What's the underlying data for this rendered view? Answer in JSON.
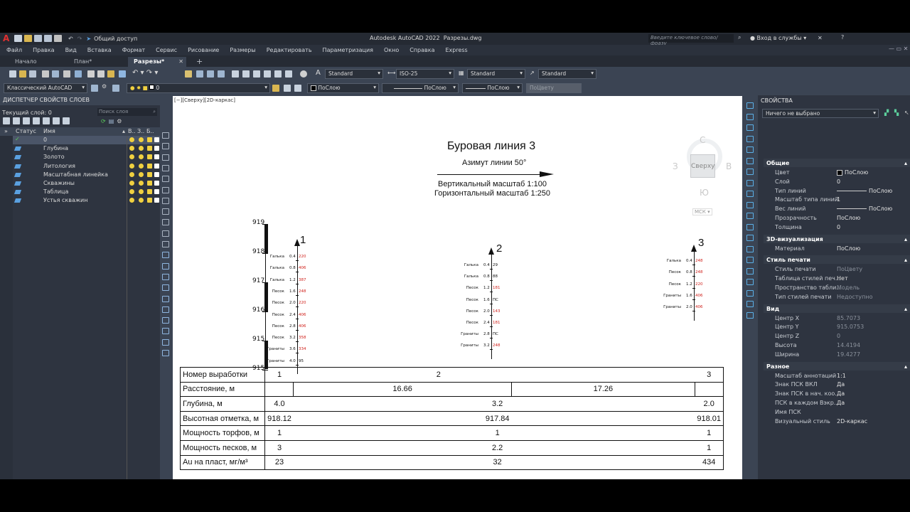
{
  "window": {
    "app_title": "Autodesk AutoCAD 2022",
    "file_name": "Разрезы.dwg",
    "share": "Общий доступ",
    "search_placeholder": "Введите ключевое слово/фразу",
    "sign_in": "Вход в службы"
  },
  "menu": [
    "Файл",
    "Правка",
    "Вид",
    "Вставка",
    "Формат",
    "Сервис",
    "Рисование",
    "Размеры",
    "Редактировать",
    "Параметризация",
    "Окно",
    "Справка",
    "Express"
  ],
  "tabs": [
    {
      "label": "Начало",
      "active": false
    },
    {
      "label": "План*",
      "active": false
    },
    {
      "label": "Разрезы*",
      "active": true
    }
  ],
  "toolbar": {
    "text_style": "Standard",
    "dim_style": "ISO-25",
    "table_style": "Standard",
    "mleader_style": "Standard",
    "workspace": "Классический AutoCAD",
    "layer": "0",
    "color": "ПоСлою",
    "linetype": "ПоСлою",
    "lineweight": "ПоСлою",
    "plotstyle": "ПоЦвету"
  },
  "layer_panel": {
    "title": "ДИСПЕТЧЕР СВОЙСТВ СЛОЕВ",
    "current": "Текущий слой: 0",
    "search_placeholder": "Поиск слоя",
    "col_status": "Статус",
    "col_name": "Имя",
    "col_flags": [
      "В..",
      "З..",
      "Б.."
    ],
    "layers": [
      "0",
      "Глубина",
      "Золото",
      "Литология",
      "Масштабная линейка",
      "Скважины",
      "Таблица",
      "Устья скважин"
    ]
  },
  "viewport_label": "[−][Сверху][2D-каркас]",
  "viewcube": {
    "top": "Сверху",
    "n": "С",
    "s": "Ю",
    "w": "З",
    "e": "В",
    "ucs": "МСК"
  },
  "drawing": {
    "title": "Буровая линия 3",
    "azimuth": "Азимут линии 50°",
    "vscale": "Вертикальный масштаб 1:100",
    "hscale": "Горизонтальный масштаб 1:250",
    "elevations": [
      "919",
      "918",
      "917",
      "916",
      "915",
      "915"
    ],
    "wells": [
      {
        "num": "1",
        "rows": [
          [
            "Галька",
            "0.4",
            "220"
          ],
          [
            "Галька",
            "0.8",
            "406"
          ],
          [
            "Галька",
            "1.2",
            "387"
          ],
          [
            "Песок",
            "1.6",
            "248"
          ],
          [
            "Песок",
            "2.0",
            "220"
          ],
          [
            "Песок",
            "2.4",
            "406"
          ],
          [
            "Песок",
            "2.8",
            "406"
          ],
          [
            "Песок",
            "3.2",
            "358"
          ],
          [
            "Граниты",
            "3.6",
            "334"
          ],
          [
            "Граниты",
            "4.0",
            "95"
          ]
        ]
      },
      {
        "num": "2",
        "rows": [
          [
            "Галька",
            "0.4",
            "29"
          ],
          [
            "Галька",
            "0.8",
            "88"
          ],
          [
            "Песок",
            "1.2",
            "181"
          ],
          [
            "Песок",
            "1.6",
            "ПС"
          ],
          [
            "Песок",
            "2.0",
            "143"
          ],
          [
            "Песок",
            "2.4",
            "181"
          ],
          [
            "Граниты",
            "2.8",
            "ПС"
          ],
          [
            "Граниты",
            "3.2",
            "248"
          ]
        ]
      },
      {
        "num": "3",
        "rows": [
          [
            "Галька",
            "0.4",
            "248"
          ],
          [
            "Песок",
            "0.8",
            "248"
          ],
          [
            "Песок",
            "1.2",
            "220"
          ],
          [
            "Граниты",
            "1.6",
            "406"
          ],
          [
            "Граниты",
            "2.0",
            "406"
          ]
        ]
      }
    ],
    "table": {
      "r1": [
        "Номер выработки",
        "1",
        "2",
        "3"
      ],
      "r2": [
        "Расстояние, м",
        "16.66",
        "17.26"
      ],
      "r3": [
        "Глубина, м",
        "4.0",
        "3.2",
        "2.0"
      ],
      "r4": [
        "Высотная отметка, м",
        "918.12",
        "917.84",
        "918.01"
      ],
      "r5": [
        "Мощность торфов, м",
        "1",
        "1",
        "1"
      ],
      "r6": [
        "Мощность песков, м",
        "3",
        "2.2",
        "1"
      ],
      "r7": [
        "Au на пласт, мг/м³",
        "23",
        "32",
        "434"
      ]
    }
  },
  "properties": {
    "title": "СВОЙСТВА",
    "selection": "Ничего не выбрано",
    "sections": [
      {
        "name": "Общие",
        "rows": [
          [
            "Цвет",
            "ПоСлою"
          ],
          [
            "Слой",
            "0"
          ],
          [
            "Тип линий",
            "ПоСлою"
          ],
          [
            "Масштаб типа линий",
            "1"
          ],
          [
            "Вес линий",
            "ПоСлою"
          ],
          [
            "Прозрачность",
            "ПоСлою"
          ],
          [
            "Толщина",
            "0"
          ]
        ]
      },
      {
        "name": "3D-визуализация",
        "rows": [
          [
            "Материал",
            "ПоСлою"
          ]
        ]
      },
      {
        "name": "Стиль печати",
        "rows": [
          [
            "Стиль печати",
            "ПоЦвету"
          ],
          [
            "Таблица стилей печ...",
            "Нет"
          ],
          [
            "Пространство табли...",
            "Модель"
          ],
          [
            "Тип стилей печати",
            "Недоступно"
          ]
        ]
      },
      {
        "name": "Вид",
        "rows": [
          [
            "Центр X",
            "85.7073"
          ],
          [
            "Центр Y",
            "915.0753"
          ],
          [
            "Центр Z",
            "0"
          ],
          [
            "Высота",
            "14.4194"
          ],
          [
            "Ширина",
            "19.4277"
          ]
        ]
      },
      {
        "name": "Разное",
        "rows": [
          [
            "Масштаб аннотаций",
            "1:1"
          ],
          [
            "Знак ПСК ВКЛ",
            "Да"
          ],
          [
            "Знак ПСК в нач. коо...",
            "Да"
          ],
          [
            "ПСК в каждом Вэкр...",
            "Да"
          ],
          [
            "Имя ПСК",
            ""
          ],
          [
            "Визуальный стиль",
            "2D-каркас"
          ]
        ]
      }
    ]
  }
}
